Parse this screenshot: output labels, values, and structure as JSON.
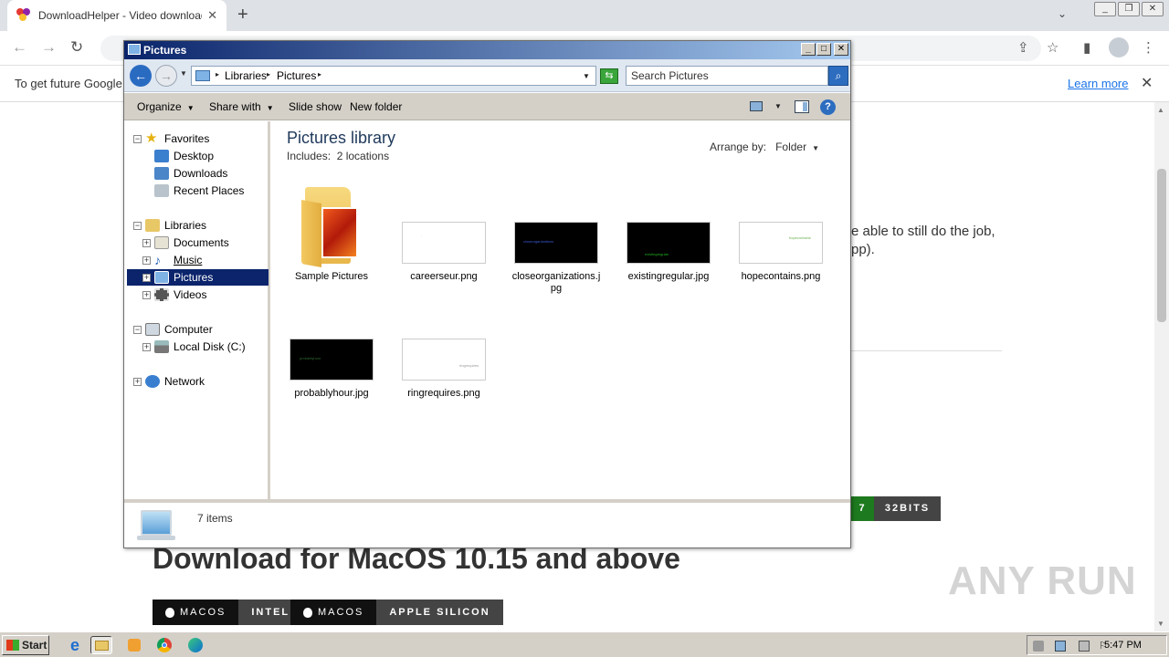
{
  "browser": {
    "tab_title": "DownloadHelper - Video download b",
    "tab_close": "✕",
    "new_tab": "+",
    "infobar_message": "To get future Google",
    "infobar_link": "Learn more",
    "infobar_close": "✕"
  },
  "page": {
    "text_line1": "e able to still do the job,",
    "text_line2": "pp).",
    "win_badge_num": "7",
    "win_badge_bits": "32BITS",
    "mac_heading": "Download for MacOS 10.15 and above",
    "mac_intel_os": "MACOS",
    "mac_intel_arch": "INTEL",
    "mac_silicon_os": "MACOS",
    "mac_silicon_arch": "APPLE SILICON",
    "watermark": "ANY RUN"
  },
  "explorer": {
    "title": "Pictures",
    "controls": {
      "minimize": "_",
      "maximize": "□",
      "close": "✕"
    },
    "breadcrumb": [
      "Libraries",
      "Pictures"
    ],
    "search_placeholder": "Search Pictures",
    "toolbar": {
      "organize": "Organize",
      "share_with": "Share with",
      "slide_show": "Slide show",
      "new_folder": "New folder",
      "help": "?"
    },
    "nav": {
      "favorites": "Favorites",
      "desktop": "Desktop",
      "downloads": "Downloads",
      "recent_places": "Recent Places",
      "libraries": "Libraries",
      "documents": "Documents",
      "music": "Music",
      "pictures": "Pictures",
      "videos": "Videos",
      "computer": "Computer",
      "local_disk": "Local Disk (C:)",
      "network": "Network"
    },
    "library_title": "Pictures library",
    "includes_label": "Includes:",
    "includes_value": "2 locations",
    "arrange_label": "Arrange by:",
    "arrange_value": "Folder",
    "files": [
      {
        "name": "Sample Pictures",
        "kind": "folder"
      },
      {
        "name": "careerseur.png",
        "kind": "light"
      },
      {
        "name": "closeorganizations.jpg",
        "kind": "dark",
        "thumb_text": "closeorganizations",
        "thumb_color": "#3b5bd8"
      },
      {
        "name": "existingregular.jpg",
        "kind": "dark",
        "thumb_text": "existingregular",
        "thumb_color": "#22b022"
      },
      {
        "name": "hopecontains.png",
        "kind": "light",
        "thumb_text": "hopecontains",
        "thumb_color": "#6ab04c"
      },
      {
        "name": "probablyhour.jpg",
        "kind": "dark",
        "thumb_text": "probablyhour",
        "thumb_color": "#2e6b2e"
      },
      {
        "name": "ringrequires.png",
        "kind": "light",
        "thumb_text": "ringrequires",
        "thumb_color": "#999999"
      }
    ],
    "status_count": "7 items"
  },
  "taskbar": {
    "start_label": "Start",
    "clock": "5:47 PM"
  }
}
